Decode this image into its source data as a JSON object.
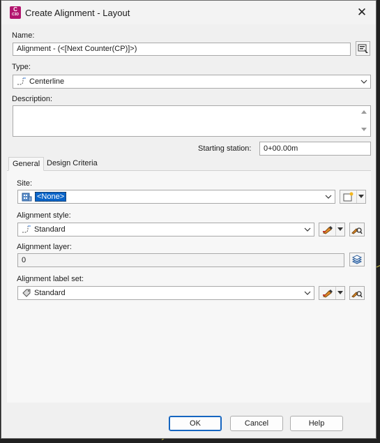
{
  "window": {
    "title": "Create Alignment - Layout",
    "app_badge_top": "C",
    "app_badge_bottom": "C3D"
  },
  "name": {
    "label": "Name:",
    "value": "Alignment - (<[Next Counter(CP)]>)"
  },
  "type": {
    "label": "Type:",
    "value": "Centerline"
  },
  "description": {
    "label": "Description:",
    "value": ""
  },
  "starting_station": {
    "label": "Starting station:",
    "value": "0+00.00m"
  },
  "tabs": [
    {
      "label": "General",
      "active": true
    },
    {
      "label": "Design Criteria",
      "active": false
    }
  ],
  "site": {
    "label": "Site:",
    "value": "<None>"
  },
  "alignment_style": {
    "label": "Alignment style:",
    "value": "Standard"
  },
  "alignment_layer": {
    "label": "Alignment layer:",
    "value": "0"
  },
  "alignment_label_set": {
    "label": "Alignment label set:",
    "value": "Standard"
  },
  "buttons": {
    "ok": "OK",
    "cancel": "Cancel",
    "help": "Help"
  },
  "colors": {
    "accent": "#1565c0",
    "app_badge": "#b2156e",
    "selection": "#0a64c8"
  }
}
